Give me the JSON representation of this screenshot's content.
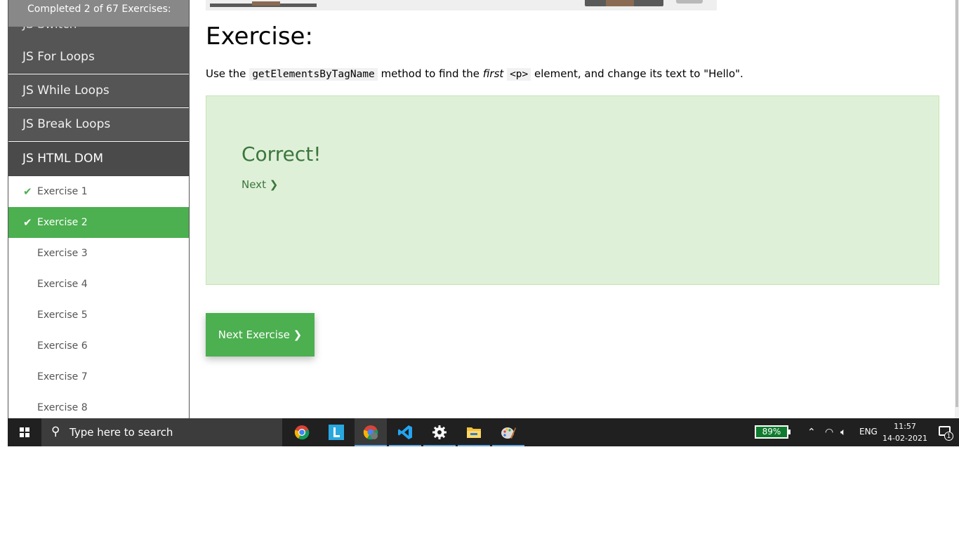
{
  "sidebar": {
    "progress": "Completed 2 of 67 Exercises:",
    "prev_item": "JS Switch",
    "topics": [
      "JS For Loops",
      "JS While Loops",
      "JS Break Loops",
      "JS HTML DOM"
    ],
    "exercises": [
      {
        "label": "Exercise 1",
        "status": "done"
      },
      {
        "label": "Exercise 2",
        "status": "selected"
      },
      {
        "label": "Exercise 3",
        "status": "todo"
      },
      {
        "label": "Exercise 4",
        "status": "todo"
      },
      {
        "label": "Exercise 5",
        "status": "todo"
      },
      {
        "label": "Exercise 6",
        "status": "todo"
      },
      {
        "label": "Exercise 7",
        "status": "todo"
      },
      {
        "label": "Exercise 8",
        "status": "todo"
      }
    ],
    "check_icon": "✔"
  },
  "main": {
    "title": "Exercise:",
    "instr_1": "Use the ",
    "instr_code_1": "getElementsByTagName",
    "instr_2": " method to find the ",
    "instr_em": "first",
    "instr_3": " ",
    "instr_code_2": "<p>",
    "instr_4": " element, and change its text to \"Hello\".",
    "result_title": "Correct!",
    "next_link": "Next ❯",
    "next_exercise_button": "Next Exercise ❯"
  },
  "taskbar": {
    "search_placeholder": "Type here to search",
    "battery": "89%",
    "language": "ENG",
    "time": "11:57",
    "date": "14-02-2021",
    "notification_count": "1"
  },
  "colors": {
    "accent_green": "#4CAF50",
    "sidebar_dark": "#555555",
    "success_bg": "#dff0d8",
    "success_text": "#3c763d"
  }
}
